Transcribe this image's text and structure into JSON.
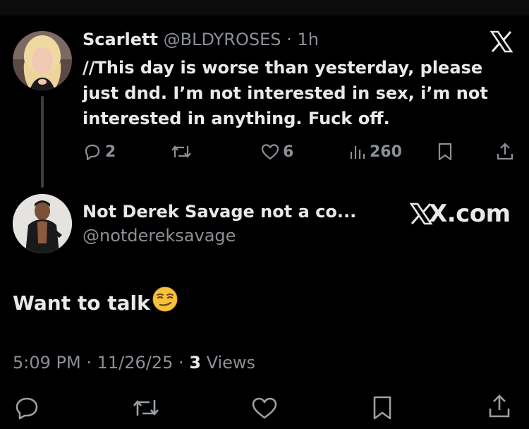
{
  "original_tweet": {
    "display_name": "Scarlett",
    "handle": "@BLDYROSES",
    "separator": "·",
    "time": "1h",
    "text": "//This day is worse than yesterday, please just dnd. I’m not interested in sex, i’m not interested in anything. Fuck off.",
    "replies": "2",
    "likes": "6",
    "views": "260"
  },
  "reply_tweet": {
    "display_name": "Not Derek Savage not a co...",
    "handle": "@notdereksavage",
    "source_label": "X.com",
    "text": "Want to talk",
    "emoji": "smirking-face",
    "timestamp": "5:09 PM · 11/26/25 · ",
    "views_count": "3",
    "views_label": " Views"
  },
  "colors": {
    "background": "#000000",
    "text_primary": "#e7e9ea",
    "text_secondary": "#8b9096",
    "thread_line": "#3a3d41"
  },
  "icons": [
    "x-logo-icon",
    "reply-icon",
    "retweet-icon",
    "like-icon",
    "views-icon",
    "bookmark-icon",
    "share-icon"
  ]
}
